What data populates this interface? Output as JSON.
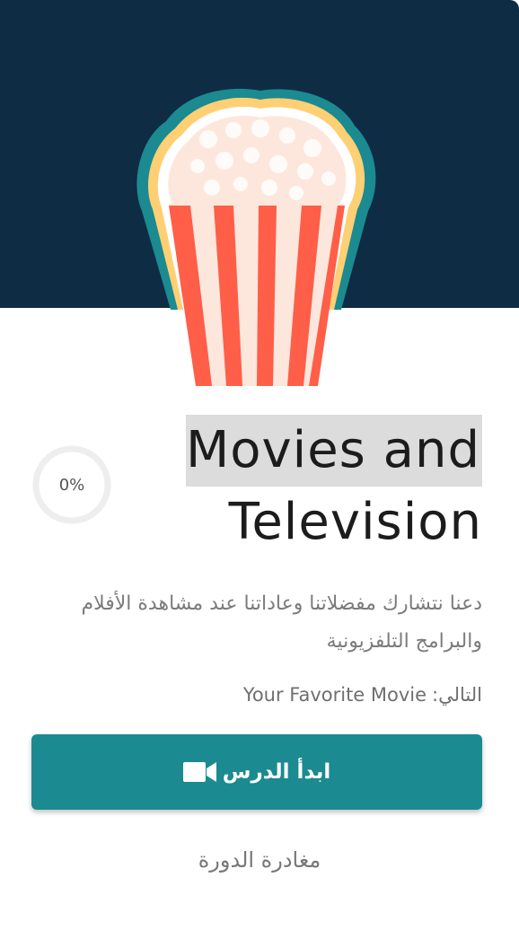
{
  "lesson": {
    "title_line1": "Movies and",
    "title_line2": "Television",
    "progress_label": "0%",
    "progress_value": 0,
    "description": "دعنا نتشارك مفضلاتنا وعاداتنا عند مشاهدة الأفلام والبرامج التلفزيونية",
    "next_label": "التالي:",
    "next_value": "Your Favorite Movie",
    "start_label": "ابدأ الدرس",
    "leave_label": "مغادرة الدورة"
  },
  "icons": {
    "hero": "popcorn-icon",
    "start": "video-camera-icon"
  },
  "colors": {
    "header_bg": "#0f2c45",
    "accent": "#1b8a91",
    "popcorn_stripe": "#ff5e48",
    "popcorn_outline": "#ffd27a"
  }
}
